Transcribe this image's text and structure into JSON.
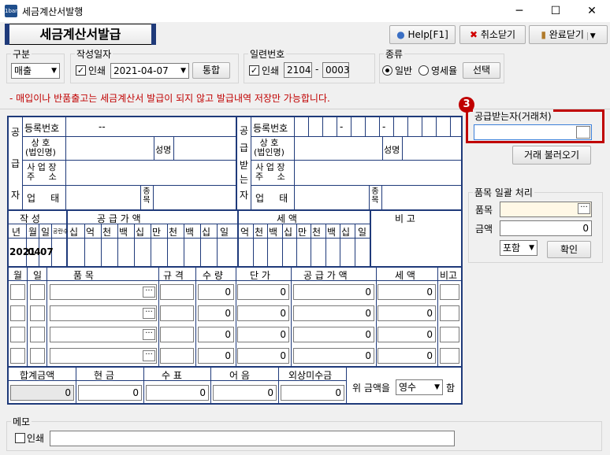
{
  "window": {
    "app_icon_label": "1bank",
    "title": "세금계산서발행",
    "min": "─",
    "max": "☐",
    "close": "✕"
  },
  "header": {
    "title": "세금계산서발급",
    "help": "Help[F1]",
    "cancel": "취소닫기",
    "done": "완료닫기"
  },
  "options": {
    "gubun_label": "구분",
    "gubun_value": "매출",
    "date_label": "작성일자",
    "date_print": "인쇄",
    "date_value": "2021-04-07",
    "integrate": "통합",
    "serial_label": "일련번호",
    "serial_print": "인쇄",
    "serial_a": "2104",
    "serial_dash": "-",
    "serial_b": "0003",
    "kind_label": "종류",
    "kind_general": "일반",
    "kind_zero": "영세율",
    "select": "선택"
  },
  "warning": "- 매입이나 반품출고는 세금계산서 발급이 되지 않고 발급내역 저장만 가능합니다.",
  "supplier": {
    "side": [
      "공",
      "급",
      "자"
    ],
    "reg_label": "등록번호",
    "reg_value": "--",
    "name_label": "상 호\n(법인명)",
    "ceo_label": "성명",
    "addr_label": "사 업 장\n주     소",
    "biz_label": "업     태",
    "item_label": "종목"
  },
  "receiver": {
    "side": [
      "공",
      "급",
      "받",
      "는",
      "자"
    ],
    "reg_label": "등록번호",
    "reg_dash1": "-",
    "reg_dash2": "-",
    "name_label": "상 호\n(법인명)",
    "ceo_label": "성명",
    "addr_label": "사 업 장\n주     소",
    "biz_label": "업     태",
    "item_label": "종목"
  },
  "summary": {
    "write": "작     성",
    "supply": "공     급     가     액",
    "tax": "세          액",
    "note": "비          고",
    "year_h": "년",
    "month_h": "월",
    "day_h": "일",
    "blank_h": "공란수",
    "digits_supply": [
      "십",
      "억",
      "천",
      "백",
      "십",
      "만",
      "천",
      "백",
      "십",
      "일"
    ],
    "digits_tax": [
      "억",
      "천",
      "백",
      "십",
      "만",
      "천",
      "백",
      "십",
      "일"
    ],
    "year": "2021",
    "month": "04",
    "day": "07"
  },
  "items": {
    "headers": [
      "월",
      "일",
      "품          목",
      "규 격",
      "수 량",
      "단 가",
      "공 급 가 액",
      "세 액",
      "비고"
    ],
    "rows": [
      {
        "qty": "0",
        "price": "0",
        "supply": "0",
        "tax": "0"
      },
      {
        "qty": "0",
        "price": "0",
        "supply": "0",
        "tax": "0"
      },
      {
        "qty": "0",
        "price": "0",
        "supply": "0",
        "tax": "0"
      },
      {
        "qty": "0",
        "price": "0",
        "supply": "0",
        "tax": "0"
      }
    ],
    "dots": "···"
  },
  "totals": {
    "headers": [
      "합계금액",
      "현     금",
      "수     표",
      "어     음",
      "외상미수금"
    ],
    "values": [
      "0",
      "0",
      "0",
      "0",
      "0"
    ],
    "tail_pre": "위 금액을",
    "tail_sel": "영수",
    "tail_post": "함"
  },
  "right": {
    "badge": "3",
    "recv_label": "공급받는자(거래처)",
    "recv_value": "",
    "load": "거래 불러오기",
    "bulk_label": "품목 일괄 처리",
    "item_label": "품목",
    "amount_label": "금액",
    "amount_value": "0",
    "incl": "포함",
    "confirm": "확인"
  },
  "memo": {
    "label": "메모",
    "print": "인쇄"
  }
}
